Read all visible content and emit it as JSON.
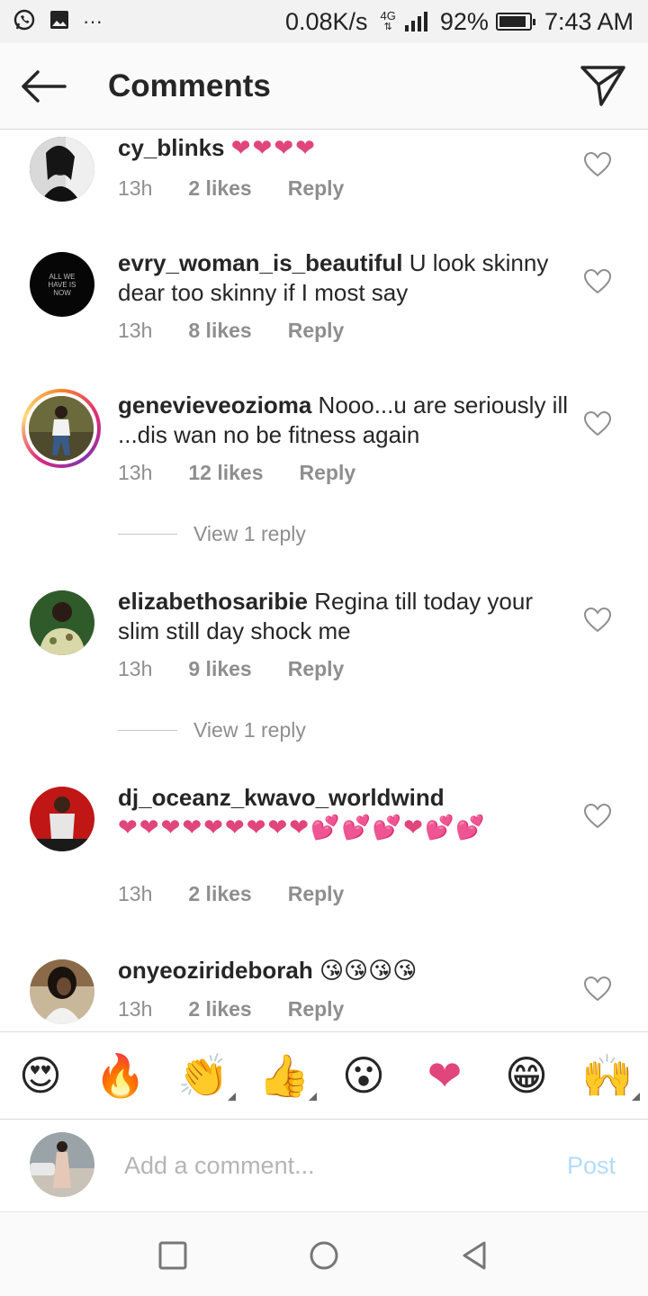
{
  "status_bar": {
    "speed": "0.08K/s",
    "network": "4G",
    "battery": "92%",
    "battery_level": 0.92,
    "time": "7:43 AM"
  },
  "header": {
    "title": "Comments"
  },
  "comments": [
    {
      "username": "cy_blinks",
      "text": "",
      "emoji": "❤❤❤❤",
      "time": "13h",
      "likes": "2 likes",
      "reply": "Reply"
    },
    {
      "username": "evry_woman_is_beautiful",
      "text": "U look skinny dear too skinny if I most say",
      "emoji": "",
      "time": "13h",
      "likes": "8 likes",
      "reply": "Reply",
      "avatar_text": "ALL WE HAVE IS NOW"
    },
    {
      "username": "genevieveozioma",
      "text": "Nooo...u are seriously ill ...dis wan no be fitness again",
      "emoji": "",
      "time": "13h",
      "likes": "12 likes",
      "reply": "Reply",
      "view_replies": "View 1 reply"
    },
    {
      "username": "elizabethosaribie",
      "text": "Regina till today your slim still day shock me",
      "emoji": "",
      "time": "13h",
      "likes": "9 likes",
      "reply": "Reply",
      "view_replies": "View 1 reply"
    },
    {
      "username": "dj_oceanz_kwavo_worldwind",
      "text": "",
      "emoji": "❤❤❤❤❤❤❤❤❤💕💕💕❤💕💕",
      "time": "13h",
      "likes": "2 likes",
      "reply": "Reply"
    },
    {
      "username": "onyeozirideborah",
      "text": "",
      "emoji": "😘😘😘😘",
      "time": "13h",
      "likes": "2 likes",
      "reply": "Reply"
    }
  ],
  "emoji_bar": [
    "😍",
    "🔥",
    "👏",
    "👍",
    "😮",
    "❤",
    "😁",
    "🙌"
  ],
  "input": {
    "placeholder": "Add a comment...",
    "post_label": "Post"
  },
  "colors": {
    "accent": "#3897f0",
    "post_disabled": "#b3dbff",
    "meta_gray": "#8e8e8e",
    "heart_pink": "#e0457b"
  }
}
